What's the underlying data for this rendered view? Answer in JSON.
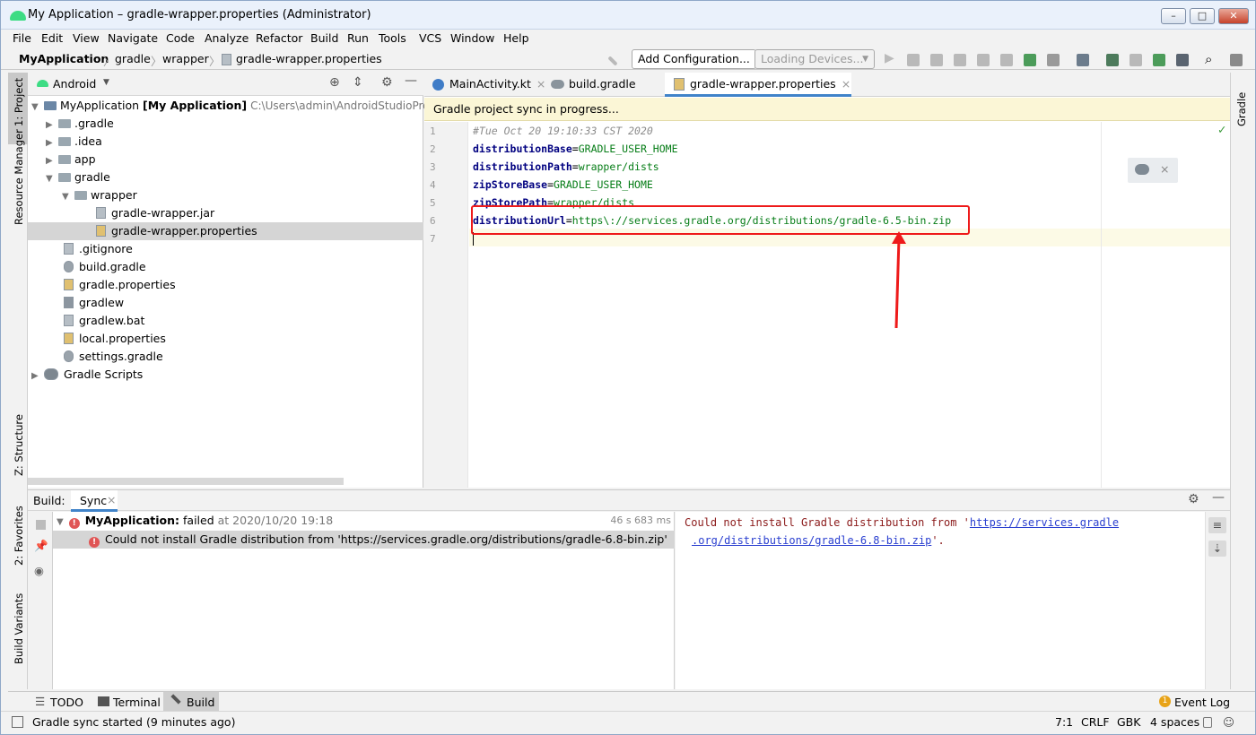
{
  "window": {
    "title": "My Application – gradle-wrapper.properties (Administrator)",
    "min": "–",
    "max": "□",
    "close": "✕"
  },
  "menu": [
    "File",
    "Edit",
    "View",
    "Navigate",
    "Code",
    "Analyze",
    "Refactor",
    "Build",
    "Run",
    "Tools",
    "VCS",
    "Window",
    "Help"
  ],
  "breadcrumb": [
    "MyApplication",
    "gradle",
    "wrapper",
    "gradle-wrapper.properties"
  ],
  "toolbar": {
    "add_config": "Add Configuration...",
    "devices": "Loading Devices..."
  },
  "left_strip": {
    "project": "1: Project",
    "resource": "Resource Manager",
    "structure": "Z: Structure",
    "favorites": "2: Favorites",
    "variants": "Build Variants"
  },
  "right_strip": {
    "gradle": "Gradle"
  },
  "project": {
    "view": "Android",
    "tree": [
      {
        "label": "MyApplication",
        "bold": "[My Application]",
        "path": "C:\\Users\\admin\\AndroidStudioProje"
      },
      {
        "label": ".gradle"
      },
      {
        "label": ".idea"
      },
      {
        "label": "app"
      },
      {
        "label": "gradle"
      },
      {
        "label": "wrapper"
      },
      {
        "label": "gradle-wrapper.jar"
      },
      {
        "label": "gradle-wrapper.properties"
      },
      {
        "label": ".gitignore"
      },
      {
        "label": "build.gradle"
      },
      {
        "label": "gradle.properties"
      },
      {
        "label": "gradlew"
      },
      {
        "label": "gradlew.bat"
      },
      {
        "label": "local.properties"
      },
      {
        "label": "settings.gradle"
      },
      {
        "label": "Gradle Scripts"
      }
    ]
  },
  "tabs": [
    {
      "label": "MainActivity.kt"
    },
    {
      "label": "build.gradle (:)"
    },
    {
      "label": "gradle-wrapper.properties"
    }
  ],
  "sync_banner": "Gradle project sync in progress...",
  "code": {
    "line1": "#Tue Oct 20 19:10:33 CST 2020",
    "l2k": "distributionBase",
    "l2v": "GRADLE_USER_HOME",
    "l3k": "distributionPath",
    "l3v": "wrapper/dists",
    "l4k": "zipStoreBase",
    "l4v": "GRADLE_USER_HOME",
    "l5k": "zipStorePath",
    "l5v": "wrapper/dists",
    "l6k": "distributionUrl",
    "l6v": "https\\://services.gradle.org/distributions/gradle-6.5-bin.zip",
    "eq": "=",
    "lines": [
      "1",
      "2",
      "3",
      "4",
      "5",
      "6",
      "7"
    ]
  },
  "build": {
    "tab_build": "Build:",
    "tab_sync": "Sync",
    "root_name": "MyApplication:",
    "root_status": "failed",
    "root_time": "at 2020/10/20 19:18",
    "duration": "46 s 683 ms",
    "error_item": "Could not install Gradle distribution from 'https://services.gradle.org/distributions/gradle-6.8-bin.zip'",
    "console_prefix": "Could not install Gradle distribution from '",
    "console_link1": "https://services.gradle",
    "console_link2": ".org/distributions/gradle-6.8-bin.zip",
    "console_suffix": "'."
  },
  "bottom_tabs": {
    "todo": "TODO",
    "terminal": "Terminal",
    "build": "Build",
    "event_log": "Event Log",
    "event_count": "1"
  },
  "status": {
    "message": "Gradle sync started (9 minutes ago)",
    "position": "7:1",
    "line_sep": "CRLF",
    "encoding": "GBK",
    "indent": "4 spaces"
  }
}
